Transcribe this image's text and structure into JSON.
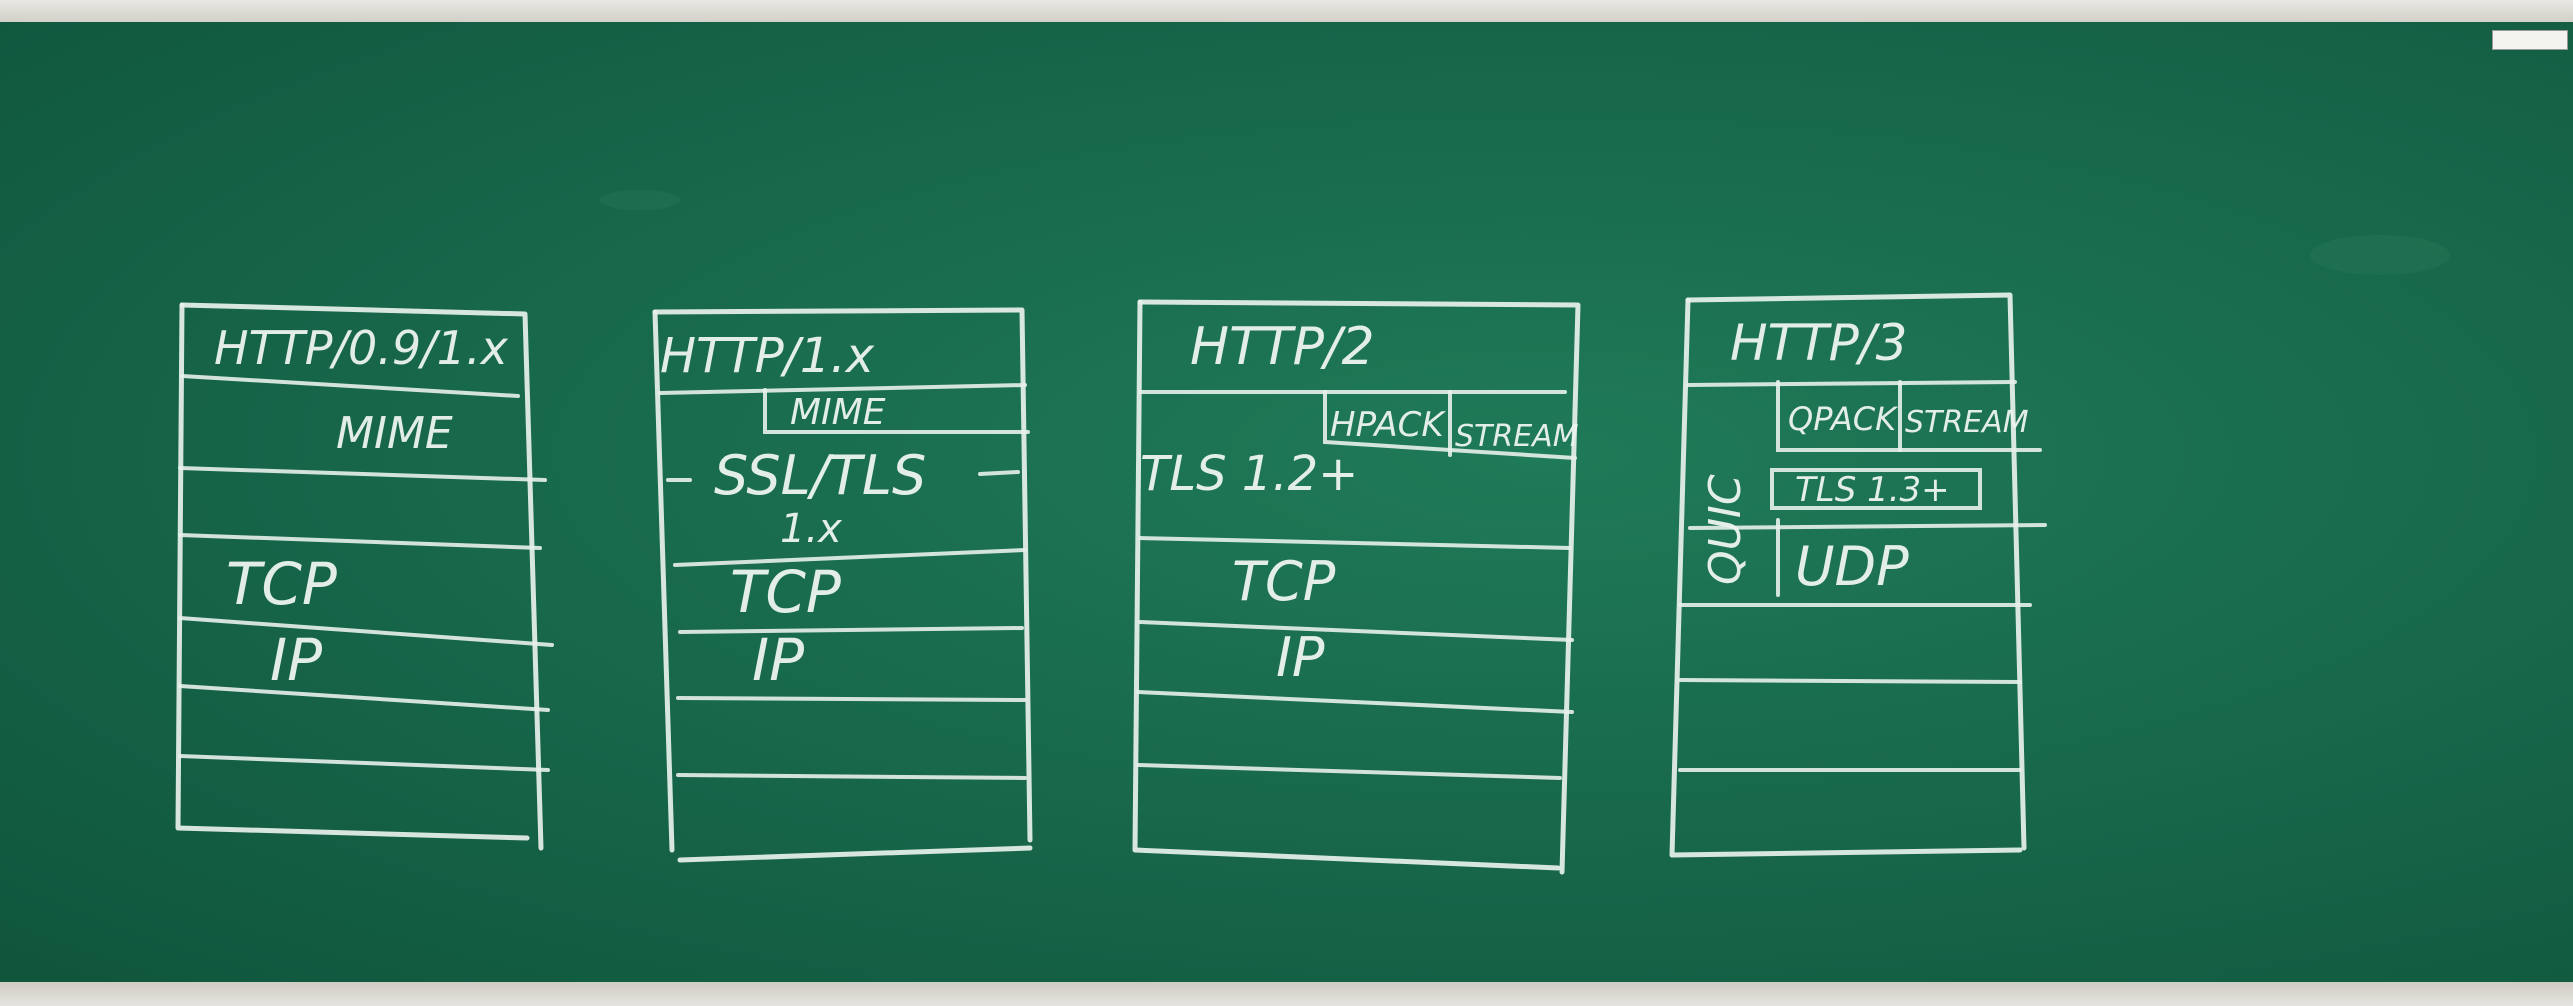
{
  "stacks": [
    {
      "protocol": "HTTP/0.9/1.x",
      "layers": {
        "mime": "MIME",
        "tcp": "TCP",
        "ip": "IP"
      }
    },
    {
      "protocol": "HTTP/1.x",
      "layers": {
        "mime": "MIME",
        "tls": "SSL/TLS",
        "tls_version": "1.x",
        "tcp": "TCP",
        "ip": "IP"
      }
    },
    {
      "protocol": "HTTP/2",
      "layers": {
        "hpack": "HPACK",
        "stream": "STREAM",
        "tls": "TLS 1.2+",
        "tcp": "TCP",
        "ip": "IP"
      }
    },
    {
      "protocol": "HTTP/3",
      "layers": {
        "qpack": "QPACK",
        "stream": "STREAM",
        "tls": "TLS 1.3+",
        "quic": "QUIC",
        "udp": "UDP"
      }
    }
  ],
  "colors": {
    "board": "#17664a",
    "chalk": "#e8f1ec",
    "frame": "#d9d6cf"
  }
}
